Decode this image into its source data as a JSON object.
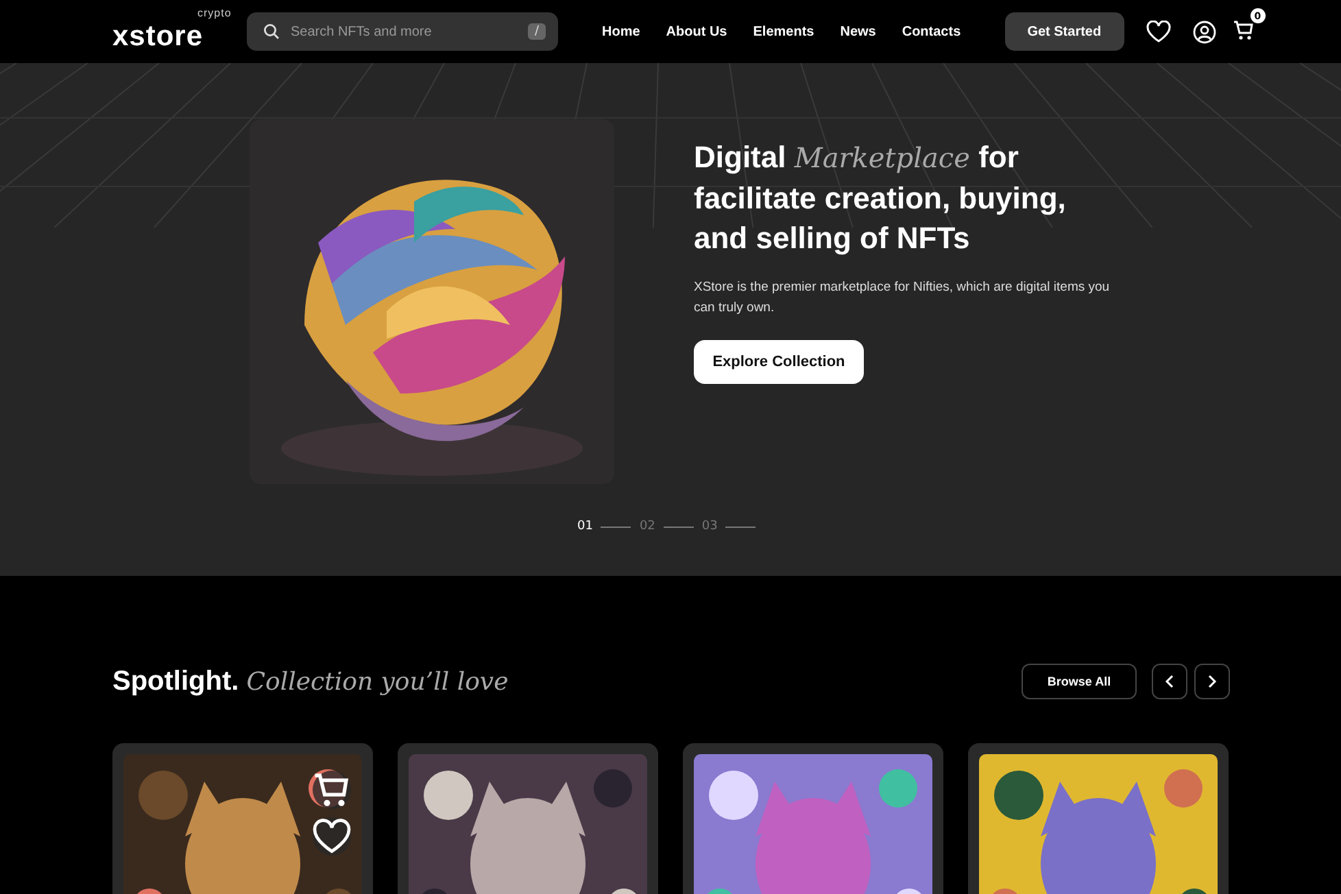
{
  "nav": {
    "logo": "xstore",
    "logo_tag": "crypto",
    "search": {
      "placeholder": "Search NFTs and more",
      "shortcut": "/"
    },
    "links": [
      "Home",
      "About Us",
      "Elements",
      "News",
      "Contacts"
    ],
    "cta": "Get Started",
    "cart_count": "0"
  },
  "hero": {
    "kind": "picture",
    "title": "Digital *Marketplace* for facilitate creation, buying, and selling of NFTs",
    "text": "XStore is the premier marketplace for Nifties, which are digital items you can truly own.",
    "button": "Explore Collection",
    "slides": [
      {
        "label": "01",
        "selected": true
      },
      {
        "label": "02",
        "selected": false
      },
      {
        "label": "03",
        "selected": false
      }
    ]
  },
  "spotlight": {
    "title": "Spotlight. *Collection you’ll love*",
    "browse": "Browse All",
    "cards": [
      {
        "kind": "picture",
        "show_actions": true
      },
      {
        "kind": "picture",
        "show_actions": false
      },
      {
        "kind": "picture",
        "show_actions": false
      },
      {
        "kind": "picture",
        "show_actions": false
      }
    ]
  }
}
